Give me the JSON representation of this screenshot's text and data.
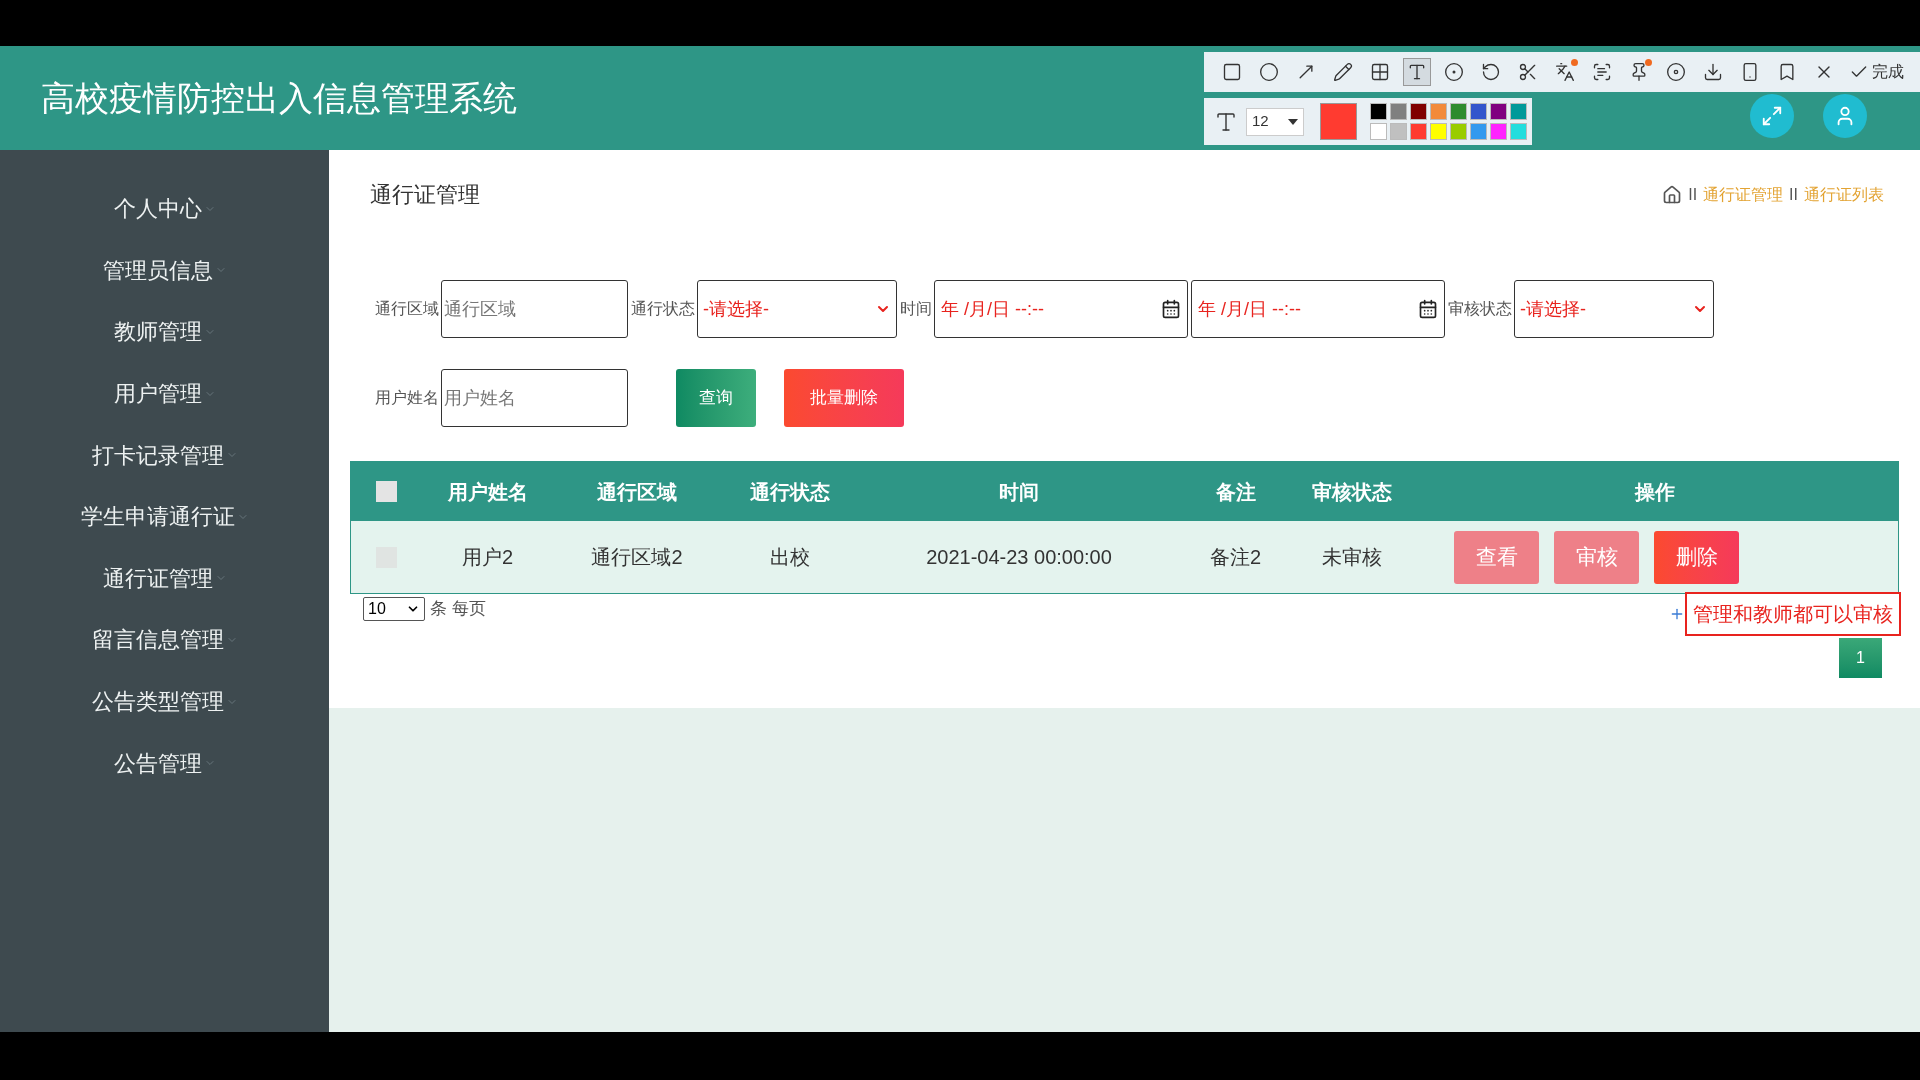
{
  "header": {
    "title": "高校疫情防控出入信息管理系统"
  },
  "capture_toolbar": {
    "tools": [
      {
        "kind": "rect",
        "selected": false,
        "badge": false
      },
      {
        "kind": "ellipse",
        "selected": false,
        "badge": false
      },
      {
        "kind": "arrow",
        "selected": false,
        "badge": false
      },
      {
        "kind": "pencil",
        "selected": false,
        "badge": false
      },
      {
        "kind": "mosaic",
        "selected": false,
        "badge": false
      },
      {
        "kind": "text",
        "selected": true,
        "badge": false
      },
      {
        "kind": "number",
        "selected": false,
        "badge": false
      },
      {
        "kind": "undo",
        "selected": false,
        "badge": false
      },
      {
        "kind": "cut",
        "selected": false,
        "badge": false
      },
      {
        "kind": "translate",
        "selected": false,
        "badge": true
      },
      {
        "kind": "ocr",
        "selected": false,
        "badge": false
      },
      {
        "kind": "pin",
        "selected": false,
        "badge": true
      },
      {
        "kind": "record",
        "selected": false,
        "badge": false
      },
      {
        "kind": "save",
        "selected": false,
        "badge": false
      },
      {
        "kind": "phone",
        "selected": false,
        "badge": false
      },
      {
        "kind": "bookmark",
        "selected": false,
        "badge": false
      },
      {
        "kind": "cancel",
        "selected": false,
        "badge": false
      }
    ],
    "done_label": "完成",
    "font_size": "12",
    "palette": [
      {
        "color": "#000000"
      },
      {
        "color": "#808080"
      },
      {
        "color": "#800000"
      },
      {
        "color": "#f28a3a"
      },
      {
        "color": "#2e8b2e"
      },
      {
        "color": "#3355cc"
      },
      {
        "color": "#800080"
      },
      {
        "color": "#009999"
      },
      {
        "color": "#ffffff"
      },
      {
        "color": "#c0c0c0"
      },
      {
        "color": "#ff3b30"
      },
      {
        "color": "#ffff00"
      },
      {
        "color": "#99cc00"
      },
      {
        "color": "#3399ee"
      },
      {
        "color": "#ff22ff"
      },
      {
        "color": "#22dddd"
      }
    ]
  },
  "sidebar": {
    "items": [
      "个人中心",
      "管理员信息",
      "教师管理",
      "用户管理",
      "打卡记录管理",
      "学生申请通行证",
      "通行证管理",
      "留言信息管理",
      "公告类型管理",
      "公告管理"
    ]
  },
  "page_title": "通行证管理",
  "breadcrumb": [
    {
      "separator": "II",
      "label": "通行证管理"
    },
    {
      "separator": "II",
      "label": "通行证列表"
    }
  ],
  "filters": [
    [
      {
        "kind": "text",
        "label": "通行区域",
        "placeholder": "通行区域"
      },
      {
        "kind": "select",
        "label": "通行状态",
        "value": "-请选择-"
      },
      {
        "kind": "datetime",
        "label": "时间",
        "value": "年 /月/日 --:--"
      },
      {
        "kind": "datetime",
        "value": "年 /月/日 --:--"
      },
      {
        "kind": "select",
        "label": "审核状态",
        "value": "-请选择-"
      }
    ],
    [
      {
        "kind": "text",
        "label": "用户姓名",
        "placeholder": "用户姓名"
      },
      {
        "kind": "search_button",
        "label": "查询"
      },
      {
        "kind": "delete_button",
        "label": "批量删除"
      }
    ]
  ],
  "table": {
    "select_all": {
      "checked": false
    },
    "columns": [
      "用户姓名",
      "通行区域",
      "通行状态",
      "时间",
      "备注",
      "审核状态",
      "操作"
    ],
    "rows": [
      {
        "checked": false,
        "cells": [
          "用户2",
          "通行区域2",
          "出校",
          "2021-04-23 00:00:00",
          "备注2",
          "未审核"
        ],
        "actions": [
          {
            "kind": "view",
            "label": "查看"
          },
          {
            "kind": "audit",
            "label": "审核"
          },
          {
            "kind": "delete",
            "label": "删除"
          }
        ]
      }
    ]
  },
  "pagination": {
    "page_size": "10",
    "per_page_label": "条 每页",
    "pages": [
      {
        "label": "1",
        "selected": true
      }
    ]
  },
  "annotation": {
    "text": "管理和教师都可以审核"
  }
}
